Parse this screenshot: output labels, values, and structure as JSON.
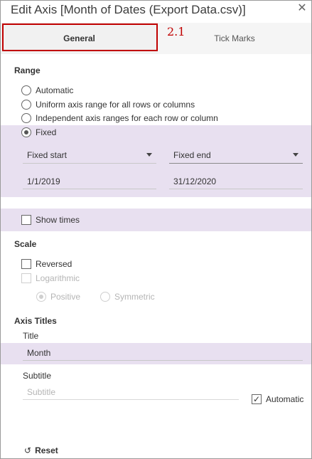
{
  "dialog": {
    "title": "Edit Axis [Month of Dates (Export Data.csv)]",
    "close_glyph": "✕"
  },
  "tabs": [
    {
      "label": "General",
      "selected": true
    },
    {
      "label": "Tick Marks",
      "selected": false
    }
  ],
  "annotation": {
    "label": "2.1",
    "color": "#c00000"
  },
  "range": {
    "heading": "Range",
    "options": [
      {
        "label": "Automatic",
        "checked": false
      },
      {
        "label": "Uniform axis range for all rows or columns",
        "checked": false
      },
      {
        "label": "Independent axis ranges for each row or column",
        "checked": false
      },
      {
        "label": "Fixed",
        "checked": true
      }
    ],
    "fixed_start": {
      "selected": "Fixed start",
      "value": "1/1/2019"
    },
    "fixed_end": {
      "selected": "Fixed end",
      "value": "31/12/2020"
    },
    "show_times": {
      "label": "Show times",
      "checked": false
    }
  },
  "scale": {
    "heading": "Scale",
    "reversed": {
      "label": "Reversed",
      "checked": false
    },
    "logarithmic": {
      "label": "Logarithmic",
      "checked": false,
      "disabled": true
    },
    "positive": {
      "label": "Positive",
      "checked": true,
      "disabled": true
    },
    "symmetric": {
      "label": "Symmetric",
      "checked": false,
      "disabled": true
    }
  },
  "axis_titles": {
    "heading": "Axis Titles",
    "title_label": "Title",
    "title_value": "Month",
    "subtitle_label": "Subtitle",
    "subtitle_placeholder": "Subtitle",
    "automatic": {
      "label": "Automatic",
      "checked": true,
      "check_glyph": "✓"
    }
  },
  "footer": {
    "reset_label": "Reset",
    "reset_icon": "undo-icon",
    "reset_glyph": "↺"
  },
  "colors": {
    "highlight_band": "#e8e0f0",
    "annotation": "#c00000"
  }
}
